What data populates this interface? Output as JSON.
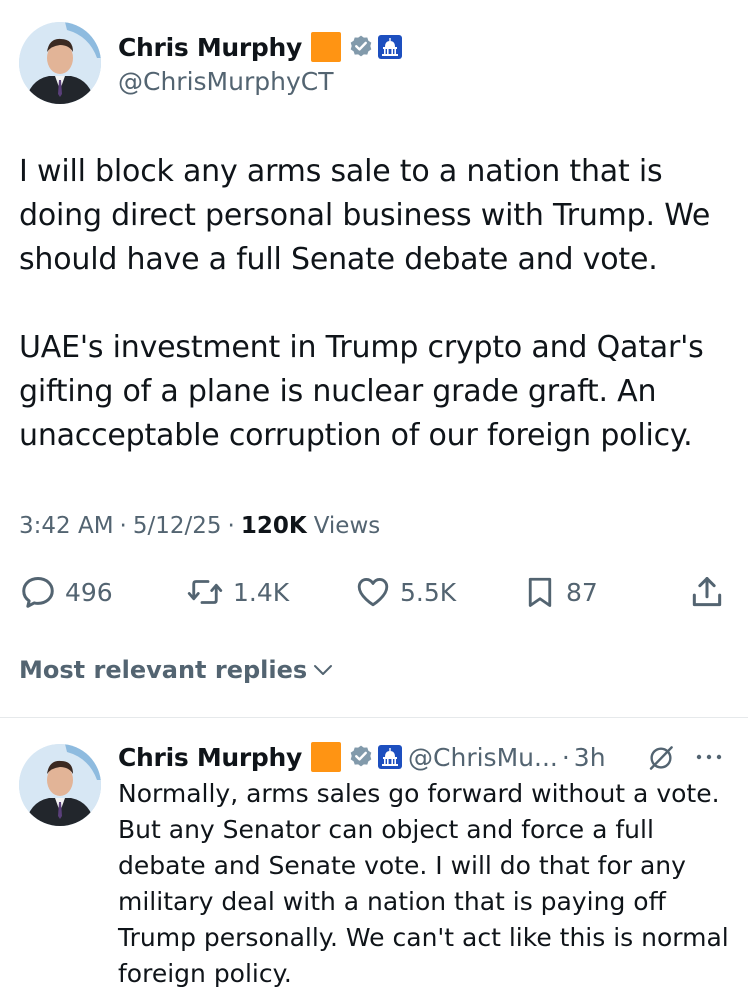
{
  "tweet": {
    "author_name": "Chris Murphy",
    "author_handle": "@ChrisMurphyCT",
    "text_p1": "I will block any arms sale to a nation that is doing direct personal business with Trump. We should have a full Senate debate and vote.",
    "text_p2": "UAE's investment in Trump crypto and Qatar's gifting of a plane is nuclear grade graft. An unacceptable corruption of our foreign policy.",
    "time": "3:42 AM",
    "date": "5/12/25",
    "views_count": "120K",
    "views_label": "Views",
    "separator": "·"
  },
  "actions": {
    "replies": "496",
    "reposts": "1.4K",
    "likes": "5.5K",
    "bookmarks": "87"
  },
  "replies_section": {
    "label": "Most relevant replies"
  },
  "reply": {
    "author_name": "Chris Murphy",
    "author_handle": "@ChrisMu...",
    "time_ago": "3h",
    "separator": "·",
    "text": "Normally, arms sales go forward without a vote. But any Senator can object and force a full debate and Senate vote. I will do that for any military deal with a nation that is paying off Trump personally. We can't act like this is normal foreign policy."
  },
  "colors": {
    "badge_orange": "#ff9413",
    "verified_gray": "#829aab",
    "capitol_blue": "#1d4fbf",
    "secondary_text": "#536471"
  },
  "icons": [
    "verified-icon",
    "capitol-icon",
    "reply-icon",
    "repost-icon",
    "like-icon",
    "bookmark-icon",
    "share-icon",
    "chevron-down-icon",
    "grok-icon",
    "more-icon"
  ]
}
